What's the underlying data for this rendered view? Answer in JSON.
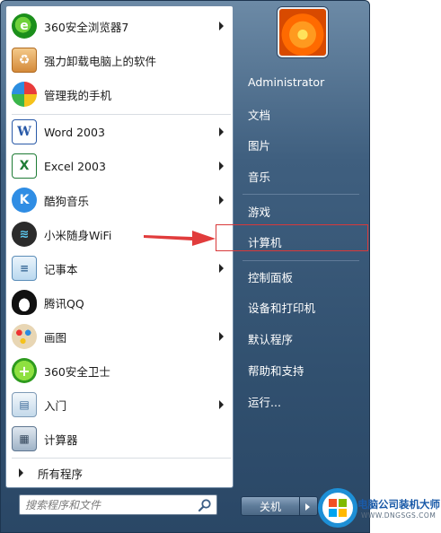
{
  "programs": [
    {
      "label": "360安全浏览器7",
      "icon": "360-browser-icon",
      "submenu": true
    },
    {
      "label": "强力卸载电脑上的软件",
      "icon": "uninstall-box-icon",
      "submenu": false
    },
    {
      "label": "管理我的手机",
      "icon": "phone-manager-icon",
      "submenu": false
    },
    {
      "label": "Word 2003",
      "icon": "word-icon",
      "submenu": true
    },
    {
      "label": "Excel 2003",
      "icon": "excel-icon",
      "submenu": true
    },
    {
      "label": "酷狗音乐",
      "icon": "kugou-icon",
      "submenu": true
    },
    {
      "label": "小米随身WiFi",
      "icon": "wifi-icon",
      "submenu": false
    },
    {
      "label": "记事本",
      "icon": "notepad-icon",
      "submenu": true
    },
    {
      "label": "腾讯QQ",
      "icon": "qq-penguin-icon",
      "submenu": false
    },
    {
      "label": "画图",
      "icon": "paint-palette-icon",
      "submenu": true
    },
    {
      "label": "360安全卫士",
      "icon": "360-safe-icon",
      "submenu": false
    },
    {
      "label": "入门",
      "icon": "getting-started-icon",
      "submenu": true
    },
    {
      "label": "计算器",
      "icon": "calculator-icon",
      "submenu": false
    }
  ],
  "all_programs_label": "所有程序",
  "search": {
    "placeholder": "搜索程序和文件"
  },
  "user": {
    "name": "Administrator"
  },
  "right_links": [
    {
      "label": "文档"
    },
    {
      "label": "图片"
    },
    {
      "label": "音乐"
    },
    {
      "label": "游戏"
    },
    {
      "label": "计算机"
    },
    {
      "label": "控制面板"
    },
    {
      "label": "设备和打印机"
    },
    {
      "label": "默认程序"
    },
    {
      "label": "帮助和支持"
    },
    {
      "label": "运行..."
    }
  ],
  "shutdown_label": "关机",
  "watermark": {
    "title": "电脑公司装机大师",
    "url": "WWW.DNGSGS.COM"
  },
  "colors": {
    "highlight": "#d8393a",
    "pane_dark": "#31506f",
    "arrow": "#e13c3c"
  }
}
